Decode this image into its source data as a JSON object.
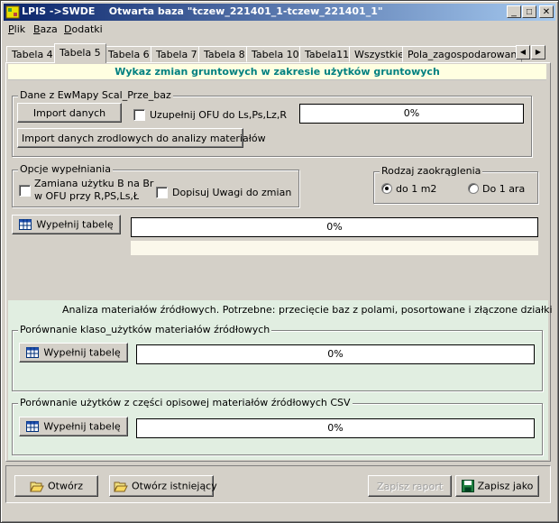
{
  "window": {
    "title": "LPIS ->SWDE    Otwarta baza \"tczew_221401_1-tczew_221401_1\"",
    "controls": {
      "minimize": "_",
      "maximize": "□",
      "close": "✕"
    }
  },
  "menu": [
    "Plik",
    "Baza",
    "Dodatki"
  ],
  "tabs": [
    "Tabela 4",
    "Tabela 5",
    "Tabela 6",
    "Tabela 7",
    "Tabela 8",
    "Tabela 10",
    "Tabela11",
    "Wszystkie",
    "Pola_zagospodarowan"
  ],
  "active_tab": "Tabela 5",
  "tab_scroll": {
    "left": "◀",
    "right": "▶"
  },
  "header": "Wykaz zmian gruntowych w zakresie użytków gruntowych",
  "dane_group": {
    "title": "Dane z EwMapy Scal_Prze_baz",
    "import_button": "Import danych",
    "uzupelnij_checkbox": "Uzupełnij OFU do Ls,Ps,Lz,R",
    "progress": "0%",
    "import_zrodlowe_button": "Import danych zrodlowych do analizy materiałów"
  },
  "opcje_group": {
    "title": "Opcje wypełniania",
    "zamiana_line1": "Zamiana użytku B na Br",
    "zamiana_line2": "w OFU przy R,PS,Ls,Ł",
    "dopisuj_checkbox": "Dopisuj  Uwagi do zmian"
  },
  "zaokraglenie_group": {
    "title": "Rodzaj zaokrąglenia",
    "options": [
      "do 1 m2",
      "Do 1 ara"
    ],
    "selected": "do 1 m2"
  },
  "wypelnij_main": {
    "button": "Wypełnij tabelę",
    "progress": "0%"
  },
  "analiza": {
    "caption": "Analiza materiałów źródłowych. Potrzebne: przecięcie baz z polami, posortowane i złączone działki",
    "group1": {
      "title": "Porównanie klaso_użytków materiałów źródłowych",
      "button": "Wypełnij tabelę",
      "progress": "0%"
    },
    "group2": {
      "title": "Porównanie użytków z części opisowej materiałów źródłowych CSV",
      "button": "Wypełnij tabelę",
      "progress": "0%"
    }
  },
  "bottom": {
    "otworz": "Otwórz",
    "otworz_istniejacy": "Otwórz istniejący",
    "zapisz_raport": "Zapisz raport",
    "zapisz_jako": "Zapisz jako"
  },
  "colors": {
    "titlebar_start": "#0a246a",
    "titlebar_end": "#a6caf0",
    "header_text": "#008080",
    "header_bg": "#ffffe1",
    "analysis_bg": "#e1eee1"
  }
}
